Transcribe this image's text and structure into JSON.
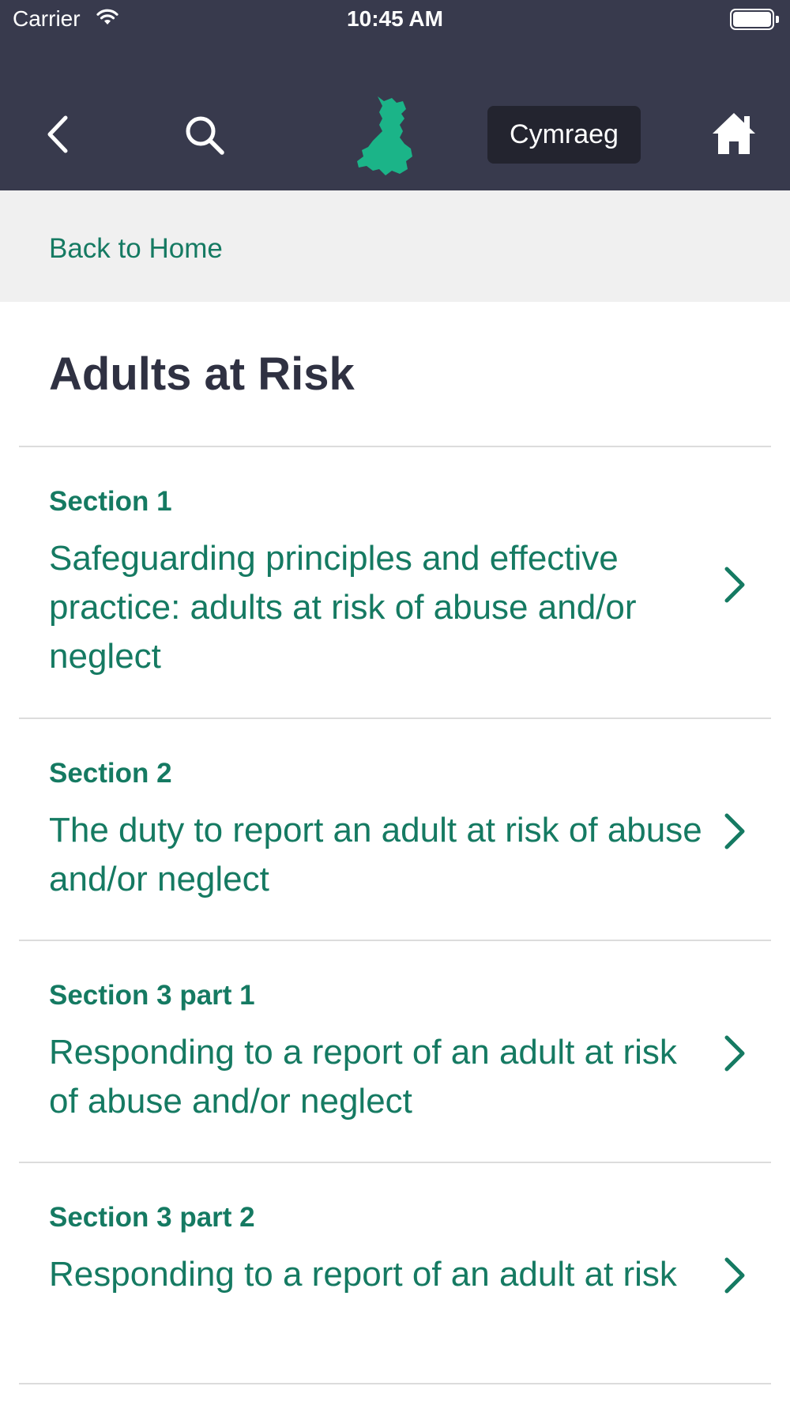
{
  "status_bar": {
    "carrier": "Carrier",
    "time": "10:45 AM"
  },
  "nav": {
    "back_icon": "chevron-left-icon",
    "search_icon": "search-icon",
    "logo_icon": "wales-map-icon",
    "language_button": "Cymraeg",
    "home_icon": "home-icon"
  },
  "breadcrumb": {
    "back_link": "Back to Home"
  },
  "page": {
    "title": "Adults at Risk"
  },
  "sections": [
    {
      "label": "Section 1",
      "title": "Safeguarding principles and effective practice: adults at risk of abuse and/or neglect"
    },
    {
      "label": "Section 2",
      "title": "The duty to report an adult at risk of abuse and/or neglect"
    },
    {
      "label": "Section 3 part 1",
      "title": "Responding to a report of an adult at risk of abuse and/or neglect"
    },
    {
      "label": "Section 3 part 2",
      "title": "Responding to a report of an adult at risk"
    }
  ],
  "colors": {
    "header_bg": "#383a4d",
    "accent_green": "#157a62",
    "logo_green": "#1bb488",
    "breadcrumb_bg": "#f0f0f0",
    "title_text": "#2f3142",
    "language_button_bg": "#23242f"
  }
}
